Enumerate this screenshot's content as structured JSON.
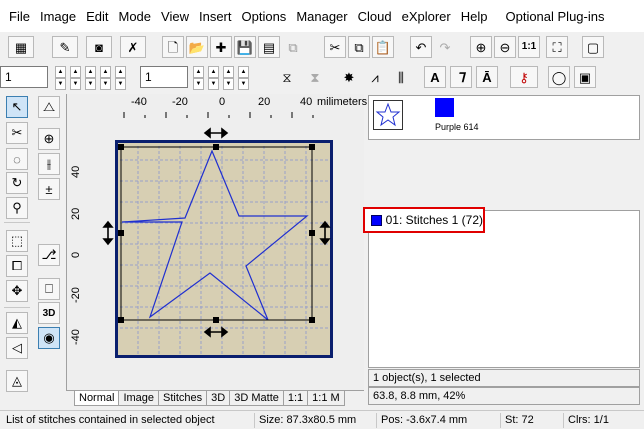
{
  "menu": [
    "File",
    "Image",
    "Edit",
    "Mode",
    "View",
    "Insert",
    "Options",
    "Manager",
    "Cloud",
    "eXplorer",
    "Help",
    "Optional Plug-ins"
  ],
  "toolbar2": {
    "combo1_value": "1",
    "combo2_value": "1"
  },
  "ruler": {
    "unit_label": "milimeters",
    "h_ticks": [
      "-40",
      "-20",
      "0",
      "20",
      "40"
    ],
    "v_ticks": [
      "40",
      "20",
      "0",
      "-20",
      "-40"
    ]
  },
  "tabs": [
    "Normal",
    "Image",
    "Stitches",
    "3D",
    "3D Matte",
    "1:1",
    "1:1 M"
  ],
  "colors": {
    "accent": "#0000ff",
    "hoop_border": "#0a1f6e",
    "fabric": "#d7cfb3",
    "highlight": "#e00000"
  },
  "thread": {
    "name": "Purple 614"
  },
  "stitch_list": {
    "item_index": "01:",
    "item_label": "Stitches 1 (72)"
  },
  "info": {
    "selection": "1 object(s), 1 selected",
    "dimensions": "63.8, 8.8 mm, 42%"
  },
  "status": {
    "hint": "List of stitches contained in selected object",
    "size": "Size: 87.3x80.5 mm",
    "pos": "Pos: -3.6x7.4 mm",
    "stitches": "St: 72",
    "colors": "Clrs: 1/1"
  }
}
